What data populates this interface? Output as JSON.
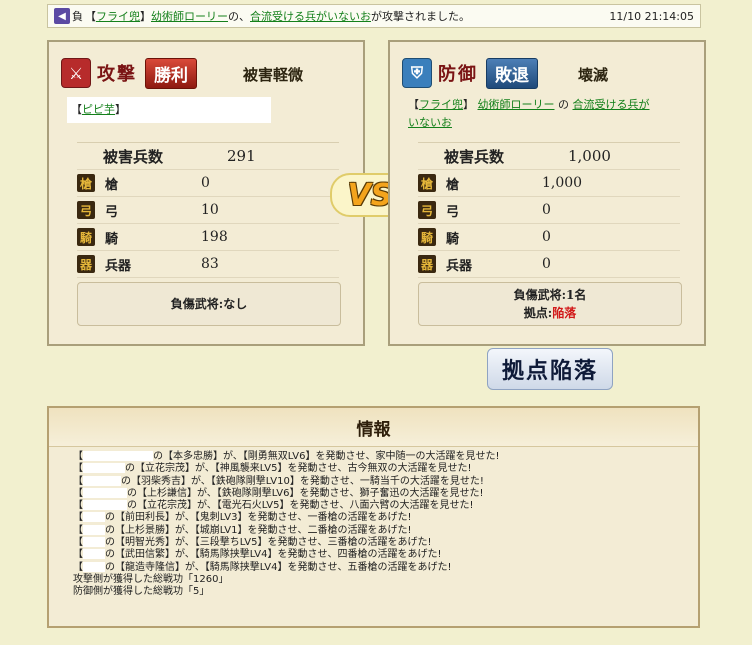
{
  "notice": {
    "badge": "◀",
    "kanji": "負",
    "p1": "【",
    "player": "フライ兜",
    "p2": "】",
    "general": "幼術師ローリー",
    "sep": "の、",
    "stronghold": "合流受ける兵がいないお",
    "suffix": "が攻撃されました。",
    "time": "11/10 21:14:05"
  },
  "attacker": {
    "role": "攻撃",
    "result": "勝利",
    "damage": "被害軽微",
    "owner_open": "【",
    "owner": "ピピ芋",
    "owner_close": "】",
    "total_label": "被害兵数",
    "total": "291",
    "units": [
      {
        "label": "槍",
        "value": "0",
        "icon": "spear-icon"
      },
      {
        "label": "弓",
        "value": "10",
        "icon": "bow-icon"
      },
      {
        "label": "騎",
        "value": "198",
        "icon": "horse-icon"
      },
      {
        "label": "兵器",
        "value": "83",
        "icon": "siege-icon"
      }
    ],
    "wounded": "負傷武将:なし"
  },
  "defender": {
    "role": "防御",
    "result": "敗退",
    "damage": "壊滅",
    "owner_open": "【",
    "owner": "フライ兜",
    "owner_mid": "】",
    "general": "幼術師ローリー",
    "no": "の",
    "stronghold": "合流受ける兵がいないお",
    "total_label": "被害兵数",
    "total": "1,000",
    "units": [
      {
        "label": "槍",
        "value": "1,000",
        "icon": "spear-icon"
      },
      {
        "label": "弓",
        "value": "0",
        "icon": "bow-icon"
      },
      {
        "label": "騎",
        "value": "0",
        "icon": "horse-icon"
      },
      {
        "label": "兵器",
        "value": "0",
        "icon": "siege-icon"
      }
    ],
    "wounded": "負傷武将:1名",
    "base_label": "拠点:",
    "base_status": "陥落"
  },
  "vs": "VS",
  "fallen_stamp": "拠点陥落",
  "info": {
    "title": "情報",
    "lines": [
      {
        "blank": 70,
        "text": "の【本多忠勝】が、【剛勇無双LV6】を発動させ、家中随一の大活躍を見せた!"
      },
      {
        "blank": 42,
        "text": "の【立花宗茂】が、【神風襲来LV5】を発動させ、古今無双の大活躍を見せた!"
      },
      {
        "blank": 38,
        "text": "の【羽柴秀吉】が、【鉄砲隊剛撃LV10】を発動させ、一騎当千の大活躍を見せた!"
      },
      {
        "blank": 44,
        "text": "の【上杉謙信】が、【鉄砲隊剛撃LV6】を発動させ、獅子奮迅の大活躍を見せた!"
      },
      {
        "blank": 44,
        "text": "の【立花宗茂】が、【電光石火LV5】を発動させ、八面六臂の大活躍を見せた!"
      },
      {
        "blank": 22,
        "text": "の【前田利長】が、【鬼刺LV3】を発動させ、一番槍の活躍をあげた!"
      },
      {
        "blank": 22,
        "text": "の【上杉景勝】が、【城崩LV1】を発動させ、二番槍の活躍をあげた!"
      },
      {
        "blank": 22,
        "text": "の【明智光秀】が、【三段撃ちLV5】を発動させ、三番槍の活躍をあげた!"
      },
      {
        "blank": 22,
        "text": "の【武田信繁】が、【騎馬隊挟撃LV4】を発動させ、四番槍の活躍をあげた!"
      },
      {
        "blank": 22,
        "text": "の【龍造寺隆信】が、【騎馬隊挟撃LV4】を発動させ、五番槍の活躍をあげた!"
      }
    ],
    "atk_merit": "攻撃側が獲得した総戦功「1260」",
    "def_merit": "防御側が獲得した総戦功「5」"
  }
}
